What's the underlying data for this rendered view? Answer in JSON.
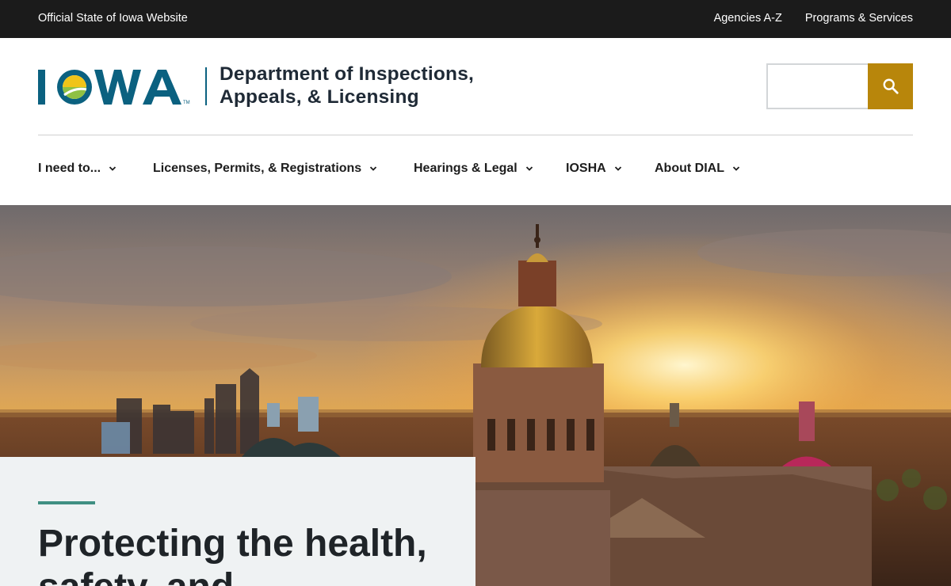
{
  "topbar": {
    "official": "Official State of Iowa Website",
    "links": [
      "Agencies A-Z",
      "Programs & Services"
    ]
  },
  "header": {
    "logo_text": "IOWA",
    "dept_line1": "Department of Inspections,",
    "dept_line2": "Appeals, & Licensing",
    "search": {
      "placeholder": "",
      "value": "",
      "button_icon": "search-icon"
    }
  },
  "nav": {
    "items": [
      {
        "label": "I need to...",
        "icon": "chevron-down-icon"
      },
      {
        "label": "Licenses, Permits, & Registrations",
        "icon": "chevron-down-icon"
      },
      {
        "label": "Hearings & Legal",
        "icon": "chevron-down-icon"
      },
      {
        "label": "IOSHA",
        "icon": "chevron-down-icon"
      },
      {
        "label": "About DIAL",
        "icon": "chevron-down-icon"
      }
    ]
  },
  "hero": {
    "image": "Iowa State Capitol at sunset",
    "headline": "Protecting the health, safety, and"
  },
  "colors": {
    "topbar_bg": "#1b1b1b",
    "brand_teal": "#0b6180",
    "search_button": "#b8860b",
    "hero_card_bg": "#eff2f3",
    "accent_line": "#3f8f82"
  }
}
